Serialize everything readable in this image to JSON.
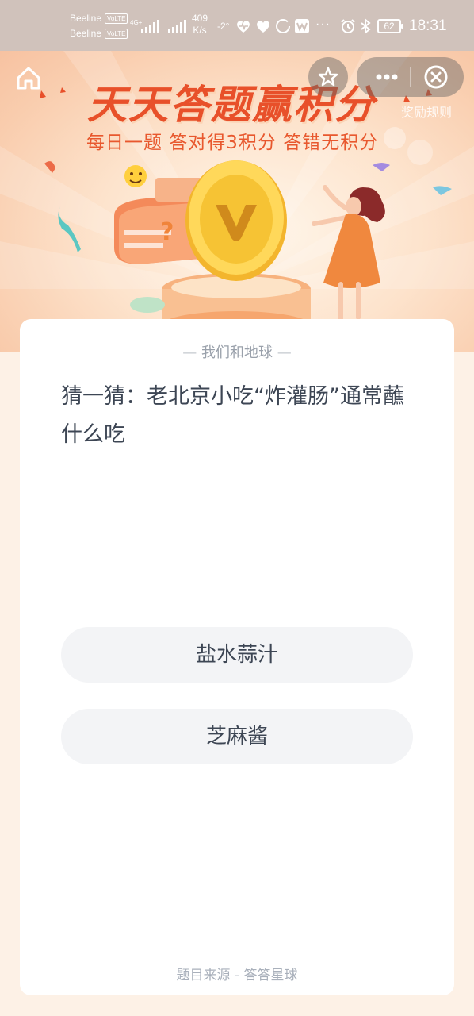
{
  "status_bar": {
    "carrier1": "Beeline",
    "carrier2": "Beeline",
    "volte": "VoLTE",
    "network": "4G+",
    "speed_value": "409",
    "speed_unit": "K/s",
    "temperature": "-2°",
    "overflow": "···",
    "battery": "62",
    "time": "18:31"
  },
  "banner": {
    "title": "天天答题赢积分",
    "subtitle": "每日一题  答对得3积分  答错无积分",
    "rules_link": "奖励规则"
  },
  "quiz": {
    "category_dash": "—",
    "category": "我们和地球",
    "question": "猜一猜：老北京小吃“炸灌肠”通常蘸什么吃",
    "options": [
      "盐水蒜汁",
      "芝麻酱"
    ],
    "source": "题目来源 - 答答星球"
  },
  "colors": {
    "accent": "#e8502a",
    "text": "#3d4654",
    "muted": "#9aa1ab",
    "option_bg": "#f3f4f6"
  }
}
